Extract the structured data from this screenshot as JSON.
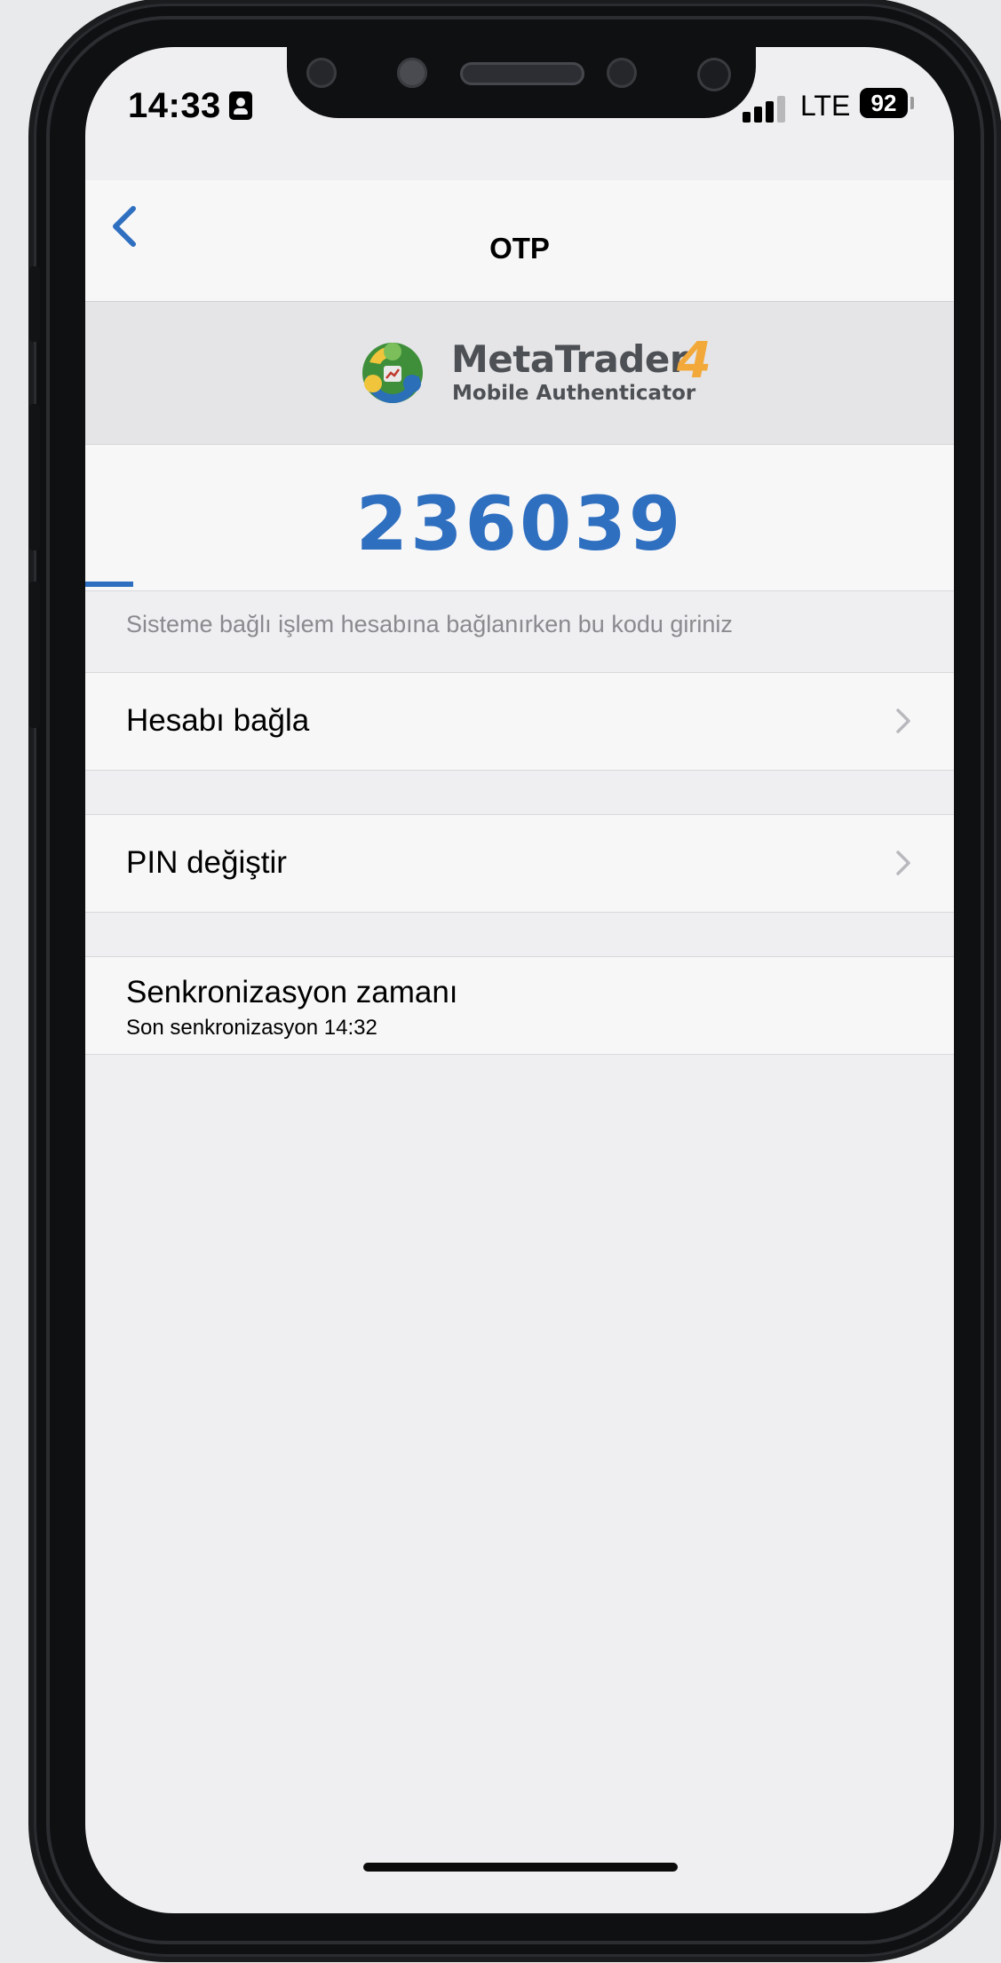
{
  "status_bar": {
    "time": "14:33",
    "network": "LTE",
    "battery": "92"
  },
  "nav": {
    "title": "OTP",
    "back_icon": "chevron-left-icon"
  },
  "logo": {
    "name": "MetaTrader",
    "version": "4",
    "subtitle": "Mobile Authenticator"
  },
  "otp": {
    "code": "236039",
    "progress_fraction": 0.055,
    "accent_color": "#2f6fc0"
  },
  "hint": "Sisteme bağlı işlem hesabına bağlanırken bu kodu giriniz",
  "menu": [
    {
      "label": "Hesabı bağla",
      "icon": "chevron-right-icon"
    },
    {
      "label": "PIN değiştir",
      "icon": "chevron-right-icon"
    }
  ],
  "sync": {
    "title": "Senkronizasyon zamanı",
    "subtitle": "Son senkronizasyon 14:32"
  }
}
